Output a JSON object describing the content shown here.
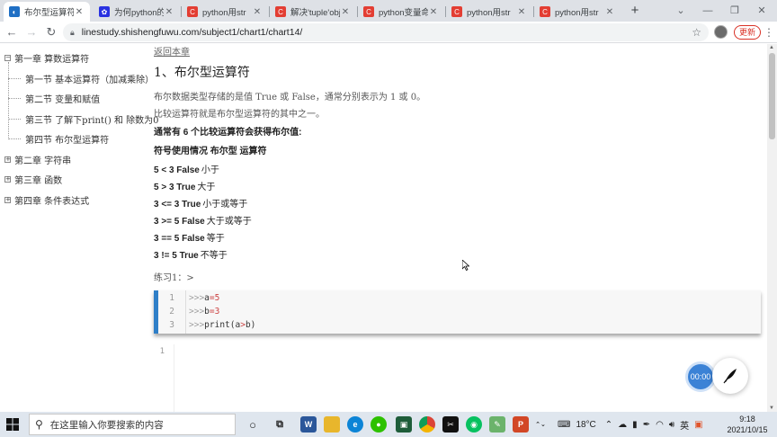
{
  "browser": {
    "tabs": [
      {
        "title": "布尔型运算符",
        "icon": "site-favicon",
        "color": "#1f6fc4",
        "active": true
      },
      {
        "title": "为何python的",
        "icon": "baidu-favicon",
        "color": "#2932e1",
        "active": false
      },
      {
        "title": "python用str",
        "icon": "csdn-favicon",
        "color": "#e33e33",
        "active": false
      },
      {
        "title": "解决'tuple'obj",
        "icon": "csdn-favicon",
        "color": "#e33e33",
        "active": false
      },
      {
        "title": "python变量命",
        "icon": "csdn-favicon",
        "color": "#e33e33",
        "active": false
      },
      {
        "title": "python用str",
        "icon": "csdn-favicon",
        "color": "#e33e33",
        "active": false
      },
      {
        "title": "python用str",
        "icon": "csdn-favicon",
        "color": "#e33e33",
        "active": false
      }
    ],
    "url": "linestudy.shishengfuwu.com/subject1/chart1/chart14/",
    "update_label": "更新"
  },
  "sidebar": {
    "chapters": [
      {
        "label": "第一章 算数运算符",
        "expanded": true,
        "sections": [
          "第一节 基本运算符（加减乘除）",
          "第二节 变量和赋值",
          "第三节 了解下print() 和 除数为0",
          "第四节 布尔型运算符"
        ]
      },
      {
        "label": "第二章 字符串",
        "expanded": false,
        "sections": []
      },
      {
        "label": "第三章 函数",
        "expanded": false,
        "sections": []
      },
      {
        "label": "第四章 条件表达式",
        "expanded": false,
        "sections": []
      }
    ]
  },
  "main": {
    "back_link": "返回本章",
    "title": "1、布尔型运算符",
    "para1": "布尔数据类型存储的是值 True 或 False，通常分别表示为 1 或 0。",
    "para2": "比较运算符就是布尔型运算符的其中之一。",
    "bold1": "通常有 6 个比较运算符会获得布尔值:",
    "bold2": "符号使用情况 布尔型 运算符",
    "comparisons": [
      {
        "expr": "5 < 3 False",
        "meaning": "小于"
      },
      {
        "expr": "5 > 3 True",
        "meaning": "大于"
      },
      {
        "expr": "3 <= 3 True",
        "meaning": "小于或等于"
      },
      {
        "expr": "3 >= 5 False",
        "meaning": "大于或等于"
      },
      {
        "expr": "3 == 5 False",
        "meaning": "等于"
      },
      {
        "expr": "3 != 5 True",
        "meaning": "不等于"
      }
    ],
    "practice_label": "练习1：>",
    "code_lines": [
      {
        "num": "1",
        "prompt": ">>>",
        "code": "a=5"
      },
      {
        "num": "2",
        "prompt": ">>>",
        "code": "b=3"
      },
      {
        "num": "3",
        "prompt": ">>>",
        "code": "print(a>b)"
      }
    ],
    "output_line_num": "1"
  },
  "floating": {
    "timer": "00:00"
  },
  "taskbar": {
    "search_placeholder": "在这里输入你要搜索的内容",
    "temperature": "18°C",
    "ime": "英",
    "time": "9:18",
    "date": "2021/10/15"
  }
}
